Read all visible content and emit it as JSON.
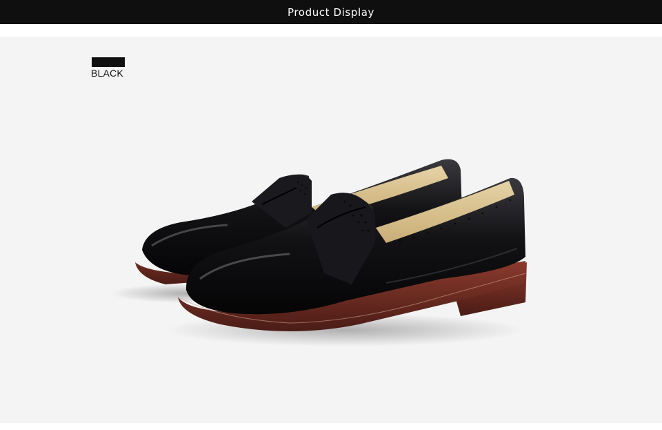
{
  "header": {
    "title": "Product Display",
    "background": "#0f0f0f",
    "text_color": "#ffffff"
  },
  "product": {
    "color_swatch": "#0f0f0f",
    "color_name": "BLACK",
    "image_subject": "shoe-pair-icon"
  },
  "panel": {
    "background": "#f4f4f4"
  }
}
